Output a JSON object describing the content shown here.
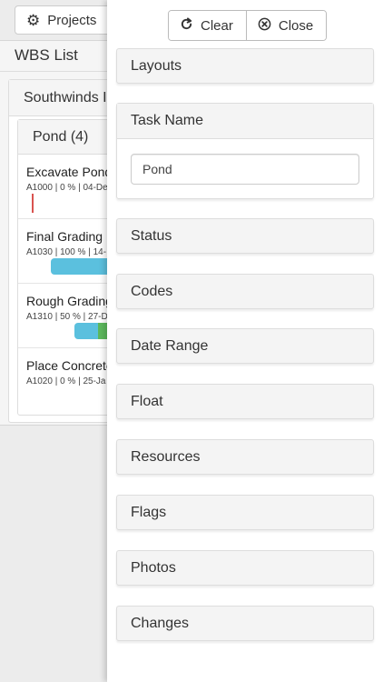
{
  "toolbar": {
    "projects_label": "Projects",
    "projects_icon": "gear-icon"
  },
  "wbs": {
    "title": "WBS List",
    "project": "Southwinds I",
    "group": {
      "title": "Pond (4)",
      "tasks": [
        {
          "name": "Excavate Pond",
          "meta": "A1000 | 0 % | 04-De"
        },
        {
          "name": "Final Grading",
          "meta": "A1030 | 100 % | 14-"
        },
        {
          "name": "Rough Grading",
          "meta": "A1310 | 50 % | 27-D"
        },
        {
          "name": "Place Concrete",
          "meta": "A1020 | 0 % | 25-Ja"
        }
      ]
    }
  },
  "drawer": {
    "clear_label": "Clear",
    "close_label": "Close",
    "sections": {
      "layouts": "Layouts",
      "task_name": "Task Name",
      "status": "Status",
      "codes": "Codes",
      "date_range": "Date Range",
      "float": "Float",
      "resources": "Resources",
      "flags": "Flags",
      "photos": "Photos",
      "changes": "Changes"
    },
    "task_name_value": "Pond"
  },
  "colors": {
    "bar_blue": "#5bc0de",
    "bar_green": "#5cb85c",
    "bar_red": "#d9534f"
  }
}
